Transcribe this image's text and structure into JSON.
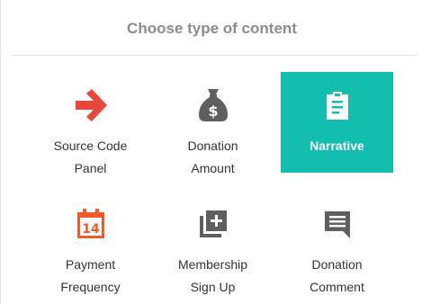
{
  "header": {
    "title": "Choose type of content"
  },
  "options": [
    {
      "line1": "Source Code",
      "line2": "Panel",
      "icon": "arrow-right-icon",
      "color": "#e8473b"
    },
    {
      "line1": "Donation",
      "line2": "Amount",
      "icon": "money-bag-icon",
      "color": "#5f5f5f"
    },
    {
      "line1": "Narrative",
      "line2": "",
      "icon": "clipboard-icon",
      "color": "#ffffff",
      "selected": true
    },
    {
      "line1": "Payment",
      "line2": "Frequency",
      "icon": "calendar-icon",
      "color": "#ef5b2a",
      "calendar_day": "14"
    },
    {
      "line1": "Membership",
      "line2": "Sign Up",
      "icon": "add-to-list-icon",
      "color": "#5f5f5f"
    },
    {
      "line1": "Donation",
      "line2": "Comment",
      "icon": "comment-icon",
      "color": "#5f5f5f"
    }
  ],
  "colors": {
    "accent": "#12bfaf",
    "title": "#8c8c8c",
    "text": "#333333"
  }
}
